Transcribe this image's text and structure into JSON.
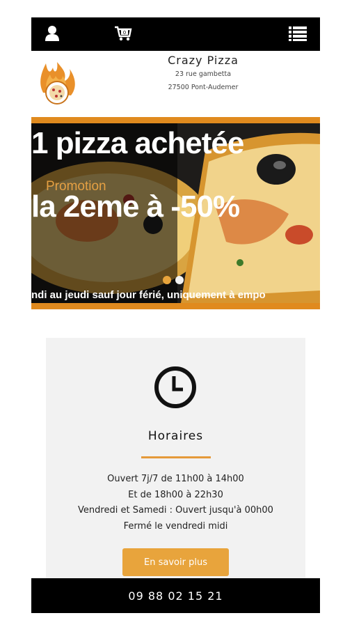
{
  "topbar": {
    "icons": [
      "user-icon",
      "cart-icon",
      "menu-list-icon"
    ],
    "cart_count": "0"
  },
  "header": {
    "shop_name": "Crazy Pizza",
    "address_line1": "23 rue gambetta",
    "address_line2": "27500 Pont-Audemer"
  },
  "banner": {
    "line1": "1 pizza achetée",
    "promo_label": "Promotion",
    "line2": "la 2eme à -50%",
    "line3": "ndi au jeudi sauf jour férié, uniquement à empo",
    "slides_total": 2,
    "active_slide": 1
  },
  "hours_card": {
    "icon": "clock-icon",
    "title": "Horaires",
    "lines": [
      "Ouvert 7j/7 de 11h00 à 14h00",
      "Et de 18h00 à 22h30",
      "Vendredi et Samedi : Ouvert jusqu'à 00h00",
      "Fermé le vendredi midi"
    ],
    "button_label": "En savoir plus"
  },
  "footer": {
    "phone": "09 88 02 15 21"
  },
  "colors": {
    "accent": "#e8a43c",
    "bar": "#000000",
    "card_bg": "#f2f2f2"
  }
}
